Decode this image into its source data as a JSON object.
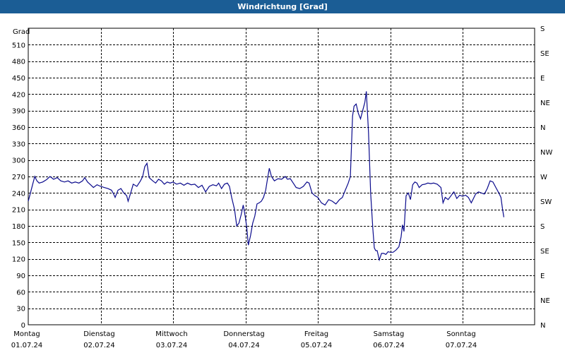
{
  "window": {
    "title": "Windrichtung [Grad]",
    "title_bar_color": "#1b5d95"
  },
  "chart_data": {
    "type": "line",
    "title": "Windrichtung [Grad]",
    "ylabel": "Grad",
    "xlabel": "",
    "ylim": [
      0,
      540
    ],
    "grid": true,
    "line_color": "#0a0a8c",
    "y_ticks_left": [
      0,
      30,
      60,
      90,
      120,
      150,
      180,
      210,
      240,
      270,
      300,
      330,
      360,
      390,
      420,
      450,
      480,
      510
    ],
    "y_ticks_right": [
      {
        "value": 0,
        "label": "N"
      },
      {
        "value": 45,
        "label": "NE"
      },
      {
        "value": 90,
        "label": "E"
      },
      {
        "value": 135,
        "label": "SE"
      },
      {
        "value": 180,
        "label": "S"
      },
      {
        "value": 225,
        "label": "SW"
      },
      {
        "value": 270,
        "label": "W"
      },
      {
        "value": 315,
        "label": "NW"
      },
      {
        "value": 360,
        "label": "N"
      },
      {
        "value": 405,
        "label": "NE"
      },
      {
        "value": 450,
        "label": "E"
      },
      {
        "value": 495,
        "label": "SE"
      },
      {
        "value": 540,
        "label": "S"
      }
    ],
    "x_range_days": [
      0,
      7
    ],
    "x_ticks": [
      {
        "day": "Montag",
        "date": "01.07.24"
      },
      {
        "day": "Dienstag",
        "date": "02.07.24"
      },
      {
        "day": "Mittwoch",
        "date": "03.07.24"
      },
      {
        "day": "Donnerstag",
        "date": "04.07.24"
      },
      {
        "day": "Freitag",
        "date": "05.07.24"
      },
      {
        "day": "Samstag",
        "date": "06.07.24"
      },
      {
        "day": "Sonntag",
        "date": "07.07.24"
      }
    ],
    "series": [
      {
        "points": [
          [
            0.0,
            225
          ],
          [
            0.03,
            240
          ],
          [
            0.06,
            255
          ],
          [
            0.09,
            270
          ],
          [
            0.12,
            262
          ],
          [
            0.15,
            258
          ],
          [
            0.2,
            260
          ],
          [
            0.25,
            264
          ],
          [
            0.3,
            270
          ],
          [
            0.35,
            265
          ],
          [
            0.4,
            268
          ],
          [
            0.45,
            262
          ],
          [
            0.5,
            260
          ],
          [
            0.55,
            262
          ],
          [
            0.6,
            258
          ],
          [
            0.65,
            260
          ],
          [
            0.7,
            258
          ],
          [
            0.75,
            262
          ],
          [
            0.78,
            268
          ],
          [
            0.82,
            260
          ],
          [
            0.86,
            255
          ],
          [
            0.9,
            250
          ],
          [
            0.95,
            255
          ],
          [
            1.0,
            252
          ],
          [
            1.05,
            250
          ],
          [
            1.1,
            248
          ],
          [
            1.15,
            245
          ],
          [
            1.18,
            238
          ],
          [
            1.2,
            232
          ],
          [
            1.24,
            245
          ],
          [
            1.28,
            248
          ],
          [
            1.32,
            240
          ],
          [
            1.36,
            235
          ],
          [
            1.38,
            225
          ],
          [
            1.42,
            242
          ],
          [
            1.45,
            256
          ],
          [
            1.5,
            252
          ],
          [
            1.55,
            262
          ],
          [
            1.58,
            270
          ],
          [
            1.61,
            288
          ],
          [
            1.64,
            294
          ],
          [
            1.67,
            268
          ],
          [
            1.72,
            262
          ],
          [
            1.76,
            258
          ],
          [
            1.8,
            265
          ],
          [
            1.84,
            262
          ],
          [
            1.88,
            256
          ],
          [
            1.92,
            260
          ],
          [
            1.96,
            258
          ],
          [
            2.0,
            260
          ],
          [
            2.05,
            256
          ],
          [
            2.1,
            258
          ],
          [
            2.15,
            254
          ],
          [
            2.2,
            258
          ],
          [
            2.25,
            255
          ],
          [
            2.3,
            256
          ],
          [
            2.35,
            250
          ],
          [
            2.4,
            254
          ],
          [
            2.45,
            242
          ],
          [
            2.5,
            252
          ],
          [
            2.55,
            255
          ],
          [
            2.6,
            253
          ],
          [
            2.63,
            258
          ],
          [
            2.67,
            248
          ],
          [
            2.71,
            256
          ],
          [
            2.75,
            258
          ],
          [
            2.78,
            252
          ],
          [
            2.81,
            232
          ],
          [
            2.85,
            210
          ],
          [
            2.88,
            180
          ],
          [
            2.91,
            185
          ],
          [
            2.94,
            200
          ],
          [
            2.97,
            218
          ],
          [
            3.0,
            195
          ],
          [
            3.02,
            175
          ],
          [
            3.04,
            145
          ],
          [
            3.07,
            162
          ],
          [
            3.1,
            185
          ],
          [
            3.13,
            198
          ],
          [
            3.16,
            220
          ],
          [
            3.19,
            222
          ],
          [
            3.22,
            225
          ],
          [
            3.25,
            232
          ],
          [
            3.28,
            245
          ],
          [
            3.3,
            262
          ],
          [
            3.33,
            285
          ],
          [
            3.36,
            270
          ],
          [
            3.4,
            262
          ],
          [
            3.45,
            266
          ],
          [
            3.5,
            265
          ],
          [
            3.55,
            270
          ],
          [
            3.58,
            265
          ],
          [
            3.62,
            266
          ],
          [
            3.66,
            258
          ],
          [
            3.7,
            250
          ],
          [
            3.75,
            248
          ],
          [
            3.8,
            252
          ],
          [
            3.85,
            260
          ],
          [
            3.88,
            258
          ],
          [
            3.92,
            240
          ],
          [
            3.96,
            235
          ],
          [
            4.0,
            232
          ],
          [
            4.05,
            222
          ],
          [
            4.1,
            218
          ],
          [
            4.15,
            228
          ],
          [
            4.2,
            225
          ],
          [
            4.25,
            220
          ],
          [
            4.3,
            228
          ],
          [
            4.34,
            232
          ],
          [
            4.38,
            245
          ],
          [
            4.42,
            258
          ],
          [
            4.45,
            270
          ],
          [
            4.48,
            380
          ],
          [
            4.5,
            398
          ],
          [
            4.53,
            402
          ],
          [
            4.56,
            385
          ],
          [
            4.59,
            375
          ],
          [
            4.62,
            390
          ],
          [
            4.65,
            405
          ],
          [
            4.67,
            425
          ],
          [
            4.7,
            350
          ],
          [
            4.73,
            240
          ],
          [
            4.76,
            175
          ],
          [
            4.78,
            140
          ],
          [
            4.8,
            135
          ],
          [
            4.82,
            135
          ],
          [
            4.85,
            118
          ],
          [
            4.88,
            130
          ],
          [
            4.91,
            130
          ],
          [
            4.94,
            128
          ],
          [
            4.97,
            133
          ],
          [
            5.0,
            132
          ],
          [
            5.04,
            132
          ],
          [
            5.08,
            136
          ],
          [
            5.12,
            142
          ],
          [
            5.15,
            160
          ],
          [
            5.17,
            182
          ],
          [
            5.19,
            170
          ],
          [
            5.22,
            235
          ],
          [
            5.25,
            240
          ],
          [
            5.28,
            228
          ],
          [
            5.31,
            255
          ],
          [
            5.34,
            260
          ],
          [
            5.37,
            258
          ],
          [
            5.4,
            250
          ],
          [
            5.44,
            255
          ],
          [
            5.48,
            256
          ],
          [
            5.52,
            258
          ],
          [
            5.56,
            257
          ],
          [
            5.6,
            258
          ],
          [
            5.65,
            256
          ],
          [
            5.7,
            250
          ],
          [
            5.73,
            222
          ],
          [
            5.76,
            232
          ],
          [
            5.8,
            228
          ],
          [
            5.84,
            235
          ],
          [
            5.88,
            242
          ],
          [
            5.92,
            230
          ],
          [
            5.96,
            236
          ],
          [
            6.0,
            234
          ],
          [
            6.04,
            236
          ],
          [
            6.08,
            232
          ],
          [
            6.12,
            222
          ],
          [
            6.15,
            230
          ],
          [
            6.18,
            238
          ],
          [
            6.22,
            242
          ],
          [
            6.26,
            240
          ],
          [
            6.3,
            238
          ],
          [
            6.34,
            248
          ],
          [
            6.38,
            262
          ],
          [
            6.42,
            260
          ],
          [
            6.46,
            250
          ],
          [
            6.5,
            240
          ],
          [
            6.53,
            232
          ],
          [
            6.55,
            212
          ],
          [
            6.57,
            196
          ]
        ]
      }
    ]
  }
}
